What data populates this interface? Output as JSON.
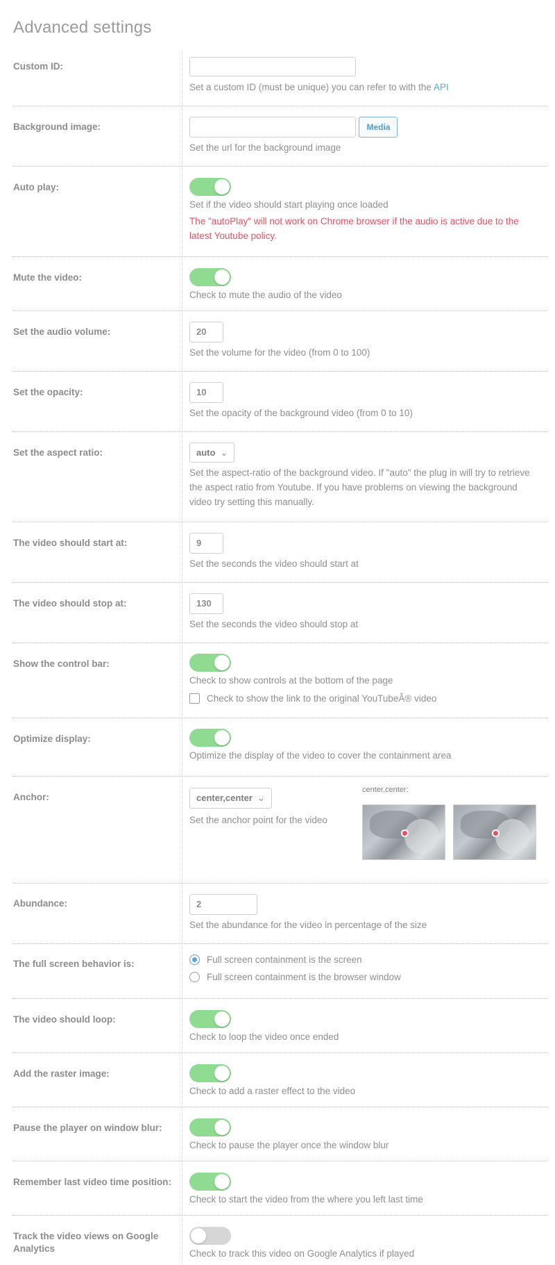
{
  "title": "Advanced settings",
  "custom_id": {
    "label": "Custom ID:",
    "value": "",
    "desc_prefix": "Set a custom ID (must be unique) you can refer to with the ",
    "desc_link": "API"
  },
  "background_image": {
    "label": "Background image:",
    "value": "",
    "button": "Media",
    "desc": "Set the url for the background image"
  },
  "auto_play": {
    "label": "Auto play:",
    "on": true,
    "desc": "Set if the video should start playing once loaded",
    "warning": "The \"autoPlay\" will not work on Chrome browser if the audio is active due to the latest Youtube policy."
  },
  "mute": {
    "label": "Mute the video:",
    "on": true,
    "desc": "Check to mute the audio of the video"
  },
  "volume": {
    "label": "Set the audio volume:",
    "value": "20",
    "desc": "Set the volume for the video (from 0 to 100)"
  },
  "opacity": {
    "label": "Set the opacity:",
    "value": "10",
    "desc": "Set the opacity of the background video (from 0 to 10)"
  },
  "aspect_ratio": {
    "label": "Set the aspect ratio:",
    "value": "auto",
    "desc": "Set the aspect-ratio of the background video. If \"auto\" the plug in will try to retrieve the aspect ratio from Youtube. If you have problems on viewing the background video try setting this manually."
  },
  "start_at": {
    "label": "The video should start at:",
    "value": "9",
    "desc": "Set the seconds the video should start at"
  },
  "stop_at": {
    "label": "The video should stop at:",
    "value": "130",
    "desc": "Set the seconds the video should stop at"
  },
  "control_bar": {
    "label": "Show the control bar:",
    "on": true,
    "desc": "Check to show controls at the bottom of the page",
    "checkbox_label": "Check to show the link to the original YouTubeÂ® video",
    "checked": false
  },
  "optimize": {
    "label": "Optimize display:",
    "on": true,
    "desc": "Optimize the display of the video to cover the containment area"
  },
  "anchor": {
    "label": "Anchor:",
    "value": "center,center",
    "desc": "Set the anchor point for the video",
    "preview_caption": "center,center:"
  },
  "abundance": {
    "label": "Abundance:",
    "value": "2",
    "desc": "Set the abundance for the video in percentage of the size"
  },
  "full_screen": {
    "label": "The full screen behavior is:",
    "options": [
      "Full screen containment is the screen",
      "Full screen containment is the browser window"
    ],
    "selected": 0
  },
  "loop": {
    "label": "The video should loop:",
    "on": true,
    "desc": "Check to loop the video once ended"
  },
  "raster": {
    "label": "Add the raster image:",
    "on": true,
    "desc": "Check to add a raster effect to the video"
  },
  "pause_blur": {
    "label": "Pause the player on window blur:",
    "on": true,
    "desc": "Check to pause the player once the window blur"
  },
  "remember": {
    "label": "Remember last video time position:",
    "on": true,
    "desc": "Check to start the video from the where you left last time"
  },
  "analytics": {
    "label": "Track the video views on Google Analytics",
    "on": false,
    "desc": "Check to track this video on Google Analytics if played"
  },
  "colors": {
    "toggle_on": "#8fdb91",
    "toggle_off": "#d6d6d6",
    "link": "#5ba7d6",
    "warning": "#e05363"
  }
}
